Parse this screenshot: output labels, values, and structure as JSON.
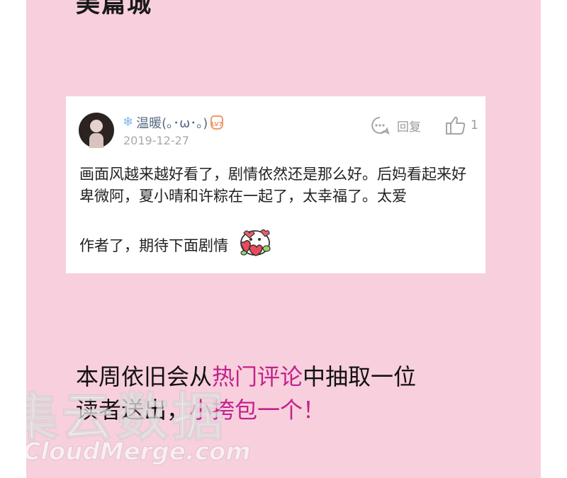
{
  "top_text": "美篇城",
  "comment_card": {
    "username": "温暖(｡･ω･｡)",
    "user_icon": "snowflake-icon",
    "level_badge": "LV7",
    "date": "2019-12-27",
    "reply_label": "回复",
    "like_count": "1",
    "comment_text": "画面风越来越好看了，剧情依然还是那么好。后妈看起来好卑微阿，夏小晴和许粽在一起了，太幸福了。太爱",
    "comment_text_end": "作者了，期待下面剧情",
    "emoji_name": "heart-hug-emoji"
  },
  "promo": {
    "part1": "本周依旧会从",
    "highlight1": "热门评论",
    "part2": "中抽取一位",
    "part3": "读者送出，",
    "highlight2": "小挎包一个！"
  },
  "watermark": {
    "cn": "集云数据",
    "en": "ACloudMerge.com"
  },
  "colors": {
    "page_background": "#f8cfdc",
    "highlight": "#c0238c",
    "username": "#586a82",
    "meta_gray": "#a9a9a9"
  }
}
